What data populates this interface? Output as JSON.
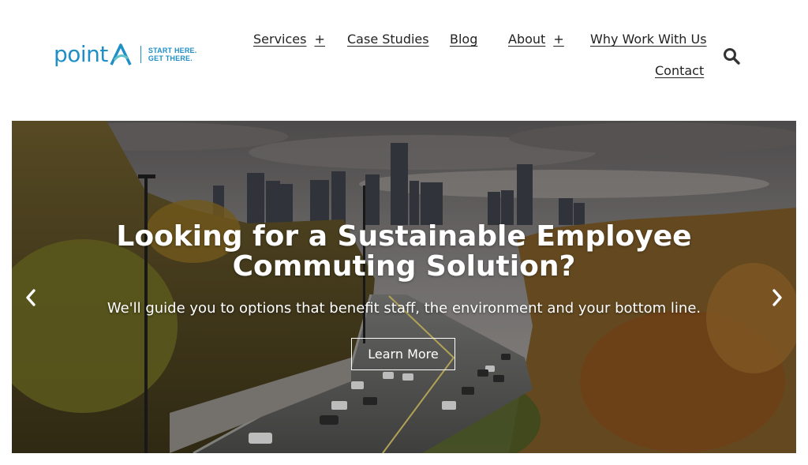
{
  "logo": {
    "word": "point",
    "tagline_1": "START HERE.",
    "tagline_2": "GET THERE."
  },
  "nav": {
    "services": "Services",
    "services_toggle": "+",
    "case_studies": "Case Studies",
    "blog": "Blog",
    "about": "About",
    "about_toggle": "+",
    "why": "Why Work With Us",
    "contact": "Contact"
  },
  "icons": {
    "search": "search-icon",
    "prev": "chevron-left-icon",
    "next": "chevron-right-icon"
  },
  "hero": {
    "title_line1": "Looking for a Sustainable Employee",
    "title_line2": "Commuting Solution?",
    "subtitle": "We'll guide you to options that benefit staff, the environment and your bottom line.",
    "cta": "Learn More"
  },
  "colors": {
    "brand": "#1f8fc6",
    "brand_accent": "#5fc3c9",
    "text": "#222222"
  }
}
